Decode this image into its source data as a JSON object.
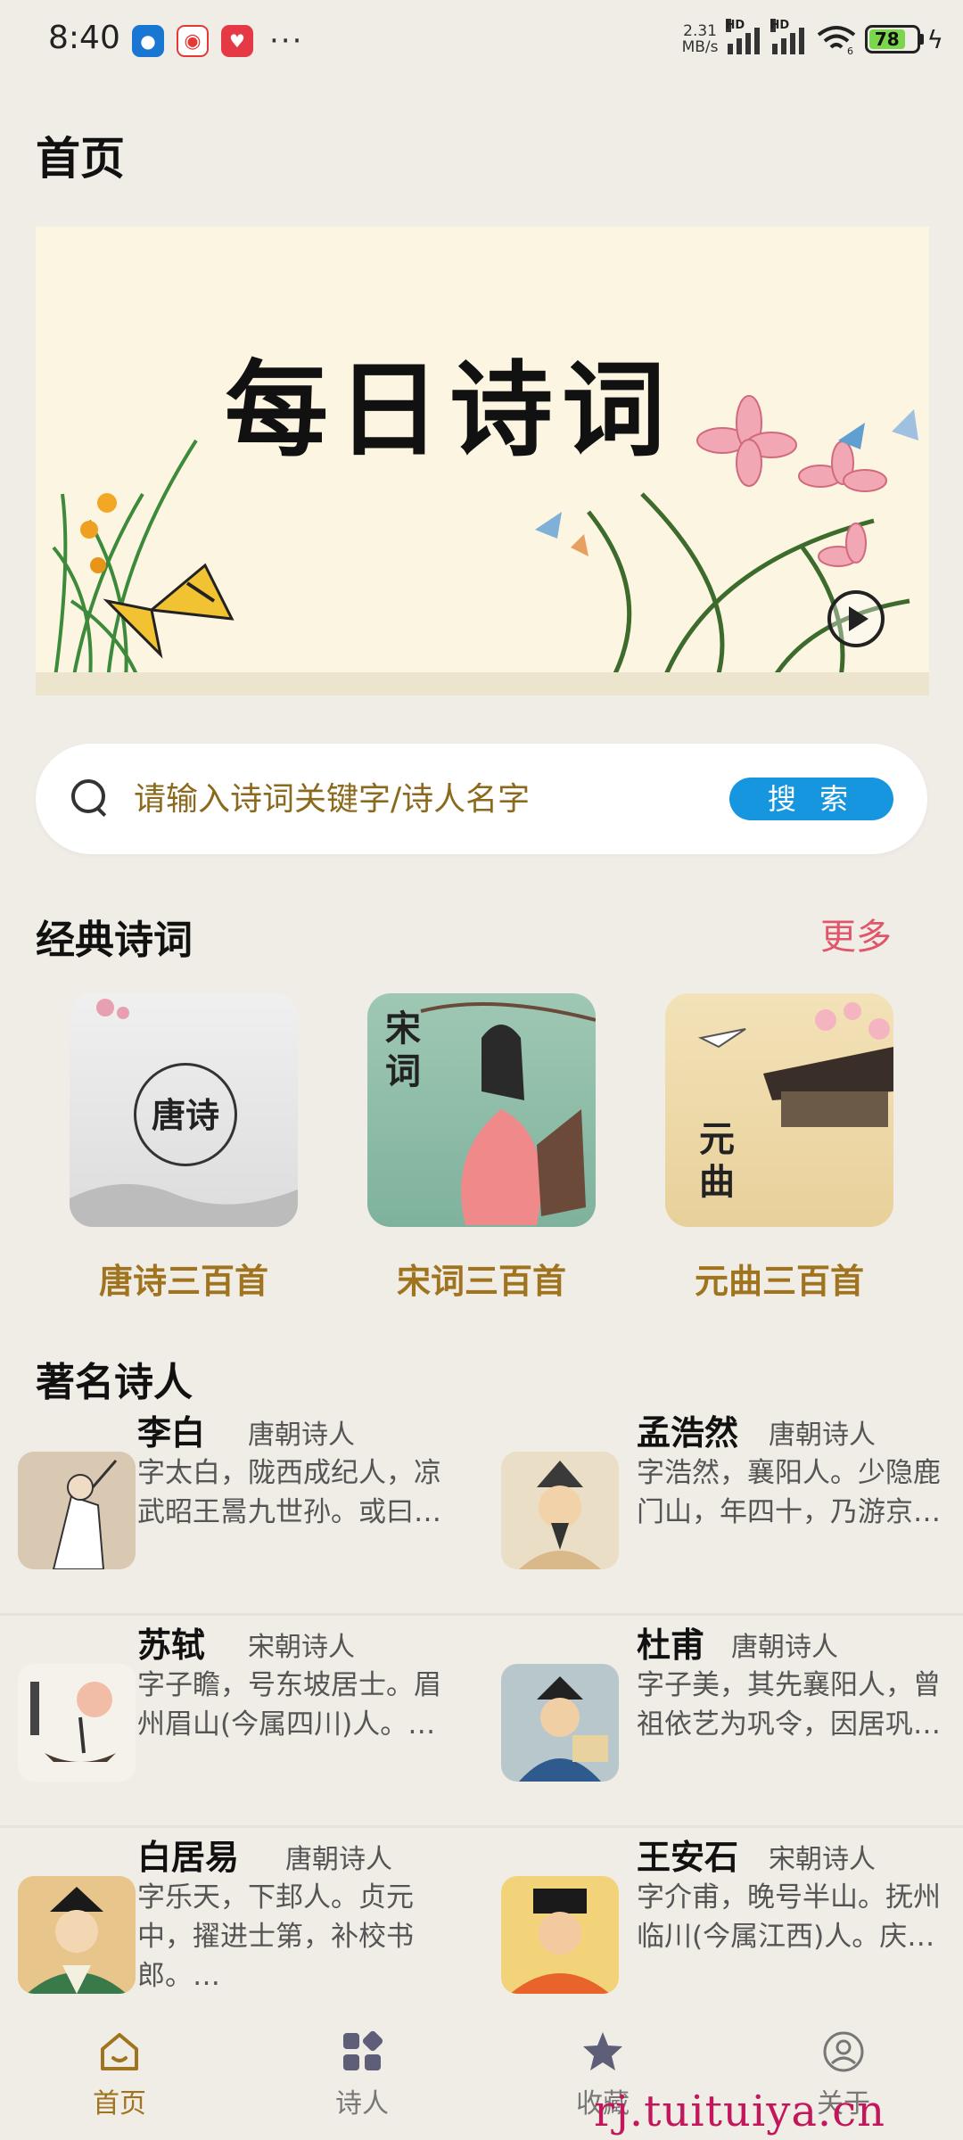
{
  "status_bar": {
    "time": "8:40",
    "net_speed_value": "2.31",
    "net_speed_unit": "MB/s",
    "signal_label": "HD",
    "wifi_badge": "6",
    "battery_level": "78",
    "battery_color": "#7ad64a"
  },
  "header": {
    "title": "首页"
  },
  "banner": {
    "title": "每日诗词"
  },
  "search": {
    "placeholder": "请输入诗词关键字/诗人名字",
    "button_label": "搜 索"
  },
  "classics": {
    "section_title": "经典诗词",
    "more_label": "更多",
    "items": [
      {
        "label": "唐诗三百首",
        "cover_text": "唐诗"
      },
      {
        "label": "宋词三百首",
        "cover_text": "宋词"
      },
      {
        "label": "元曲三百首",
        "cover_text": "元曲"
      }
    ]
  },
  "poets": {
    "section_title": "著名诗人",
    "items": [
      {
        "name": "李白",
        "dynasty": "唐朝诗人",
        "desc": "字太白，陇西成纪人，凉武昭王暠九世孙。或曰…"
      },
      {
        "name": "孟浩然",
        "dynasty": "唐朝诗人",
        "desc": "字浩然，襄阳人。少隐鹿门山，年四十，乃游京…"
      },
      {
        "name": "苏轼",
        "dynasty": "宋朝诗人",
        "desc": "字子瞻，号东坡居士。眉州眉山(今属四川)人。…"
      },
      {
        "name": "杜甫",
        "dynasty": "唐朝诗人",
        "desc": "字子美，其先襄阳人，曾祖依艺为巩令，因居巩…"
      },
      {
        "name": "白居易",
        "dynasty": "唐朝诗人",
        "desc": "字乐天，下邽人。贞元中，擢进士第，补校书郎。…"
      },
      {
        "name": "王安石",
        "dynasty": "宋朝诗人",
        "desc": "字介甫，晚号半山。抚州临川(今属江西)人。庆…"
      }
    ]
  },
  "bottom_nav": {
    "items": [
      {
        "label": "首页",
        "icon": "home-icon"
      },
      {
        "label": "诗人",
        "icon": "grid-icon"
      },
      {
        "label": "收藏",
        "icon": "star-icon"
      },
      {
        "label": "关于",
        "icon": "profile-icon"
      }
    ],
    "active_color": "#a0731e"
  },
  "watermark": "rj.tuituiya.cn"
}
